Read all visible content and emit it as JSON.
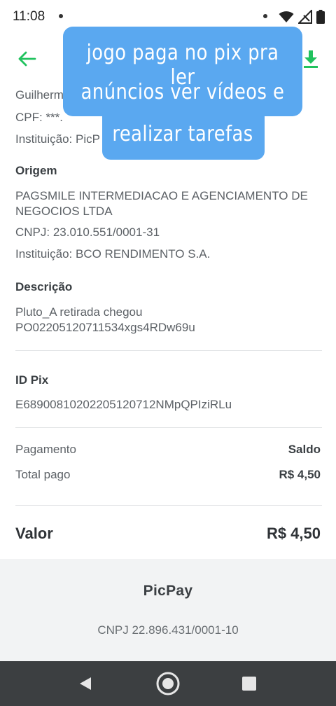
{
  "status_bar": {
    "time": "11:08"
  },
  "overlay_caption": {
    "line1": "jogo paga no pix pra ler",
    "line2": "anúncios ver vídeos e",
    "line3": "realizar tarefas"
  },
  "destino": {
    "name_partial": "Guilherm",
    "cpf_partial": "CPF: ***.",
    "instituicao_partial": "Instituição: PicP"
  },
  "origem": {
    "heading": "Origem",
    "name_line1": "PAGSMILE INTERMEDIACAO E AGENCIAMENTO DE",
    "name_line2": "NEGOCIOS LTDA",
    "cnpj": "CNPJ: 23.010.551/0001-31",
    "instituicao": "Instituição: BCO RENDIMENTO S.A."
  },
  "descricao": {
    "heading": "Descrição",
    "line1": "Pluto_A retirada chegou",
    "line2": "PO02205120711534xgs4RDw69u"
  },
  "id_pix": {
    "heading": "ID Pix",
    "value": "E68900810202205120712NMpQPIziRLu"
  },
  "pagamento": {
    "label": "Pagamento",
    "value": "Saldo"
  },
  "total_pago": {
    "label": "Total pago",
    "value": "R$ 4,50"
  },
  "valor": {
    "label": "Valor",
    "value": "R$ 4,50"
  },
  "footer": {
    "brand": "PicPay",
    "cnpj": "CNPJ 22.896.431/0001-10"
  },
  "colors": {
    "accent_green": "#21c25e",
    "caption_blue": "#5aa8f0",
    "nav_bar": "#3c3f41"
  },
  "icons": [
    "back-arrow-icon",
    "download-icon",
    "wifi-icon",
    "signal-icon",
    "battery-icon",
    "nav-back-icon",
    "nav-home-icon",
    "nav-recents-icon"
  ]
}
